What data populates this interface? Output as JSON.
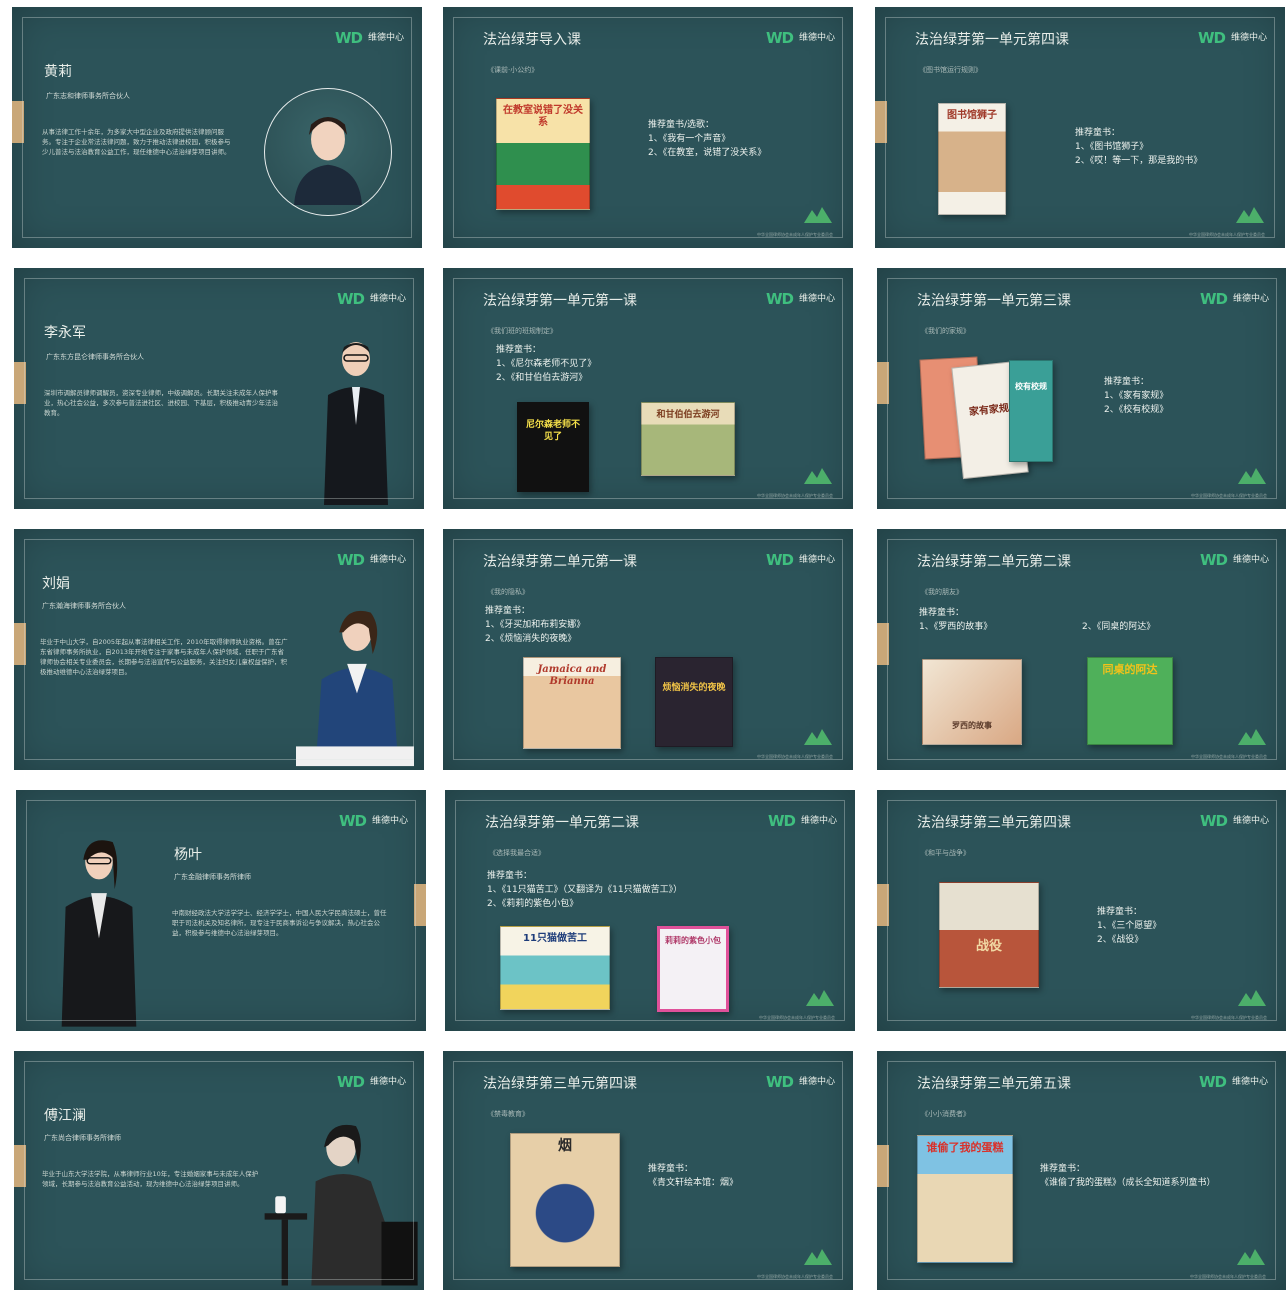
{
  "logo": {
    "mark": "WD",
    "text": "维德中心"
  },
  "people": [
    {
      "name": "黄莉",
      "role": "广东志和律师事务所合伙人",
      "bio": "从事法律工作十余年，为多家大中型企业及政府提供法律顾问服务。专注于企业常法法律问题，致力于推动法律进校园，积极参与少儿普法与法治教育公益工作，现任维德中心法治绿芽项目讲师。"
    },
    {
      "name": "李永军",
      "role": "广东东方昆仑律师事务所合伙人",
      "bio": "深圳市调解员律师调解员，资深专业律师，中级调解员。长期关注未成年人保护事业，热心社会公益，多次参与普法进社区、进校园、下基层，积极推动青少年法治教育。"
    },
    {
      "name": "刘娟",
      "role": "广东瀚海律师事务所合伙人",
      "bio": "毕业于中山大学，自2005年起从事法律相关工作，2010年取得律师执业资格。曾在广东省律师事务所执业，自2013年开始专注于家事与未成年人保护领域，任职于广东省律师协会相关专业委员会，长期参与法治宣传与公益服务，关注妇女儿童权益保护，积极推动维德中心法治绿芽项目。"
    },
    {
      "name": "杨叶",
      "role": "广东金融律师事务所律师",
      "bio": "中南财经政法大学法学学士、经济学学士，中国人民大学民商法硕士，曾任职于司法机关及知名律所，现专注于民商事诉讼与争议解决，热心社会公益，积极参与维德中心法治绿芽项目。"
    },
    {
      "name": "傅江澜",
      "role": "广东尚合律师事务所律师",
      "bio": "毕业于山东大学法学院，从事律师行业10年，专注婚姻家事与未成年人保护领域，长期参与法治教育公益活动，现为维德中心法治绿芽项目讲师。"
    }
  ],
  "lessons": [
    {
      "title": "法治绿芽导入课",
      "sub": "《课前·小公约》",
      "heading": "推荐童书/选歌：",
      "lines": [
        "1、《我有一个声音》",
        "2、《在教室，说错了没关系》"
      ],
      "books": [
        "在教室说错了没关系"
      ]
    },
    {
      "title": "法治绿芽第一单元第四课",
      "sub": "《图书馆运行规则》",
      "heading": "推荐童书：",
      "lines": [
        "1、《图书馆狮子》",
        "2、《哎！等一下，那是我的书》"
      ],
      "books": [
        "图书馆狮子"
      ]
    },
    {
      "title": "法治绿芽第一单元第一课",
      "sub": "《我们班的班规制定》",
      "heading": "推荐童书：",
      "lines": [
        "1、《尼尔森老师不见了》",
        "2、《和甘伯伯去游河》"
      ],
      "books": [
        "尼尔森老师不见了",
        "和甘伯伯去游河"
      ]
    },
    {
      "title": "法治绿芽第一单元第三课",
      "sub": "《我们的家规》",
      "heading": "推荐童书：",
      "lines": [
        "1、《家有家规》",
        "2、《校有校规》"
      ],
      "books": [
        "家有家规",
        "校有校规"
      ]
    },
    {
      "title": "法治绿芽第二单元第一课",
      "sub": "《我的隐私》",
      "heading": "推荐童书：",
      "lines": [
        "1、《牙买加和布莉安娜》",
        "2、《烦恼消失的夜晚》"
      ],
      "books": [
        "Jamaica and Brianna",
        "烦恼消失的夜晚"
      ]
    },
    {
      "title": "法治绿芽第二单元第二课",
      "sub": "《我的朋友》",
      "heading": "推荐童书：",
      "lines": [
        "1、《罗西的故事》",
        "2、《同桌的阿达》"
      ],
      "books": [
        "罗西的故事",
        "同桌的阿达"
      ]
    },
    {
      "title": "法治绿芽第一单元第二课",
      "sub": "《选择我最合适》",
      "heading": "推荐童书：",
      "lines": [
        "1、《11只猫苦工》（又翻译为《11只猫做苦工》）",
        "2、《莉莉的紫色小包》"
      ],
      "books": [
        "11只猫做苦工",
        "莉莉的紫色小包"
      ]
    },
    {
      "title": "法治绿芽第三单元第四课",
      "sub": "《和平与战争》",
      "heading": "推荐童书：",
      "lines": [
        "1、《三个愿望》",
        "2、《战役》"
      ],
      "books": [
        "战役"
      ]
    },
    {
      "title": "法治绿芽第三单元第四课",
      "sub": "《禁毒教育》",
      "heading": "推荐童书：",
      "lines": [
        "《青文轩绘本馆：烟》"
      ],
      "books": [
        "烟"
      ]
    },
    {
      "title": "法治绿芽第三单元第五课",
      "sub": "《小小消费者》",
      "heading": "推荐童书：",
      "lines": [
        "《谁偷了我的蛋糕》（成长全知道系列童书）"
      ],
      "books": [
        "谁偷了我的蛋糕"
      ]
    }
  ],
  "colors": {
    "slide_bg": "#2c5359",
    "accent_gold": "#c9a778",
    "logo_green": "#3fbf7f"
  },
  "footer_text": "中华全国律师协会未成年人保护专业委员会"
}
